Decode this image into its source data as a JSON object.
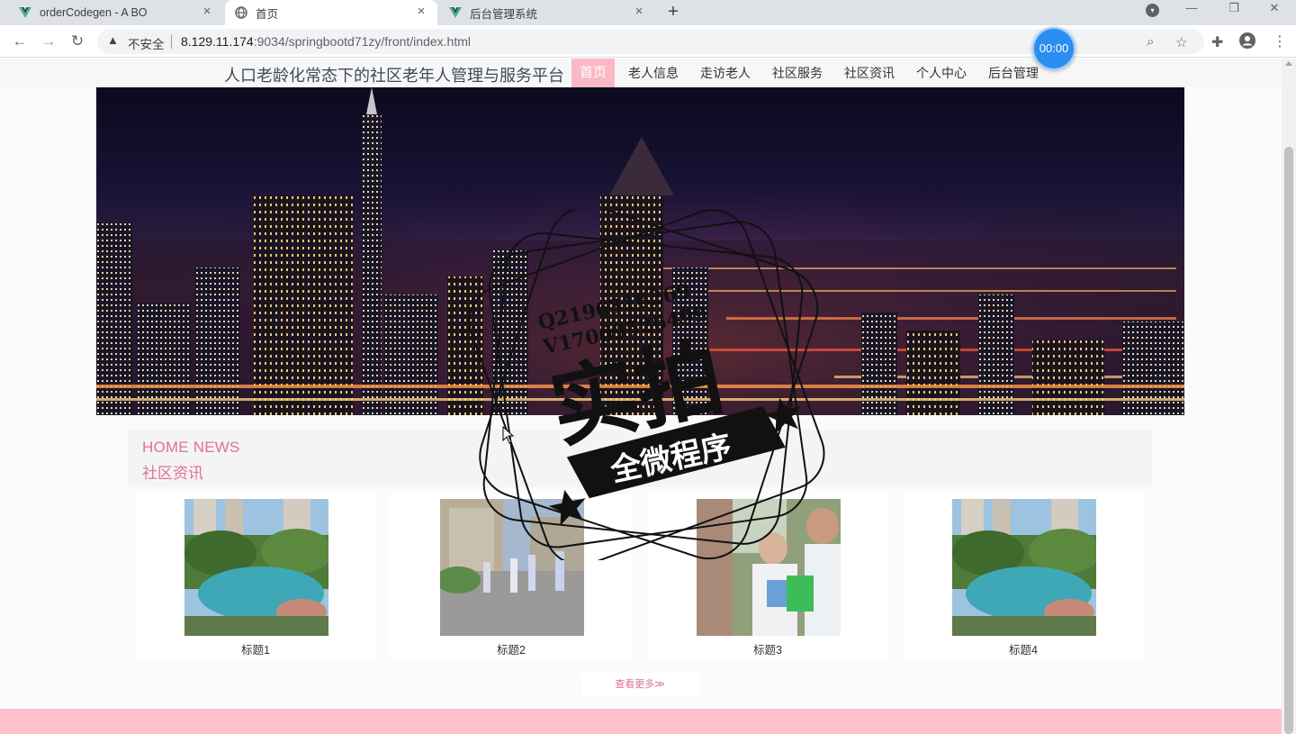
{
  "browser": {
    "tabs": [
      {
        "title": "orderCodegen - A BO",
        "icon": "vue-icon",
        "active": false
      },
      {
        "title": "首页",
        "icon": "globe-icon",
        "active": true
      },
      {
        "title": "后台管理系统",
        "icon": "vue-icon",
        "active": false
      }
    ],
    "security_label": "不安全",
    "url_host": "8.129.11.174",
    "url_rest": ":9034/springbootd71zy/front/index.html",
    "timer": "00:00"
  },
  "site": {
    "title": "人口老龄化常态下的社区老年人管理与服务平台",
    "nav": [
      {
        "label": "首页",
        "active": true
      },
      {
        "label": "老人信息",
        "active": false
      },
      {
        "label": "走访老人",
        "active": false
      },
      {
        "label": "社区服务",
        "active": false
      },
      {
        "label": "社区资讯",
        "active": false
      },
      {
        "label": "个人中心",
        "active": false
      },
      {
        "label": "后台管理",
        "active": false
      }
    ],
    "accent_color": "#e0709a",
    "active_nav_color": "#f9b8c4",
    "footer_color": "#ffc0cb"
  },
  "news": {
    "heading_en": "HOME NEWS",
    "heading_cn": "社区资讯",
    "items": [
      {
        "title": "标题1",
        "image": "garden-pond-photo"
      },
      {
        "title": "标题2",
        "image": "people-walking-photo"
      },
      {
        "title": "标题3",
        "image": "volunteers-photo"
      },
      {
        "title": "标题4",
        "image": "garden-pond-photo"
      }
    ],
    "more_label": "查看更多≫"
  },
  "watermark": {
    "line1": "Q2196316269",
    "line2": "V17069526499",
    "big": "实拍",
    "ribbon": "全微程序"
  }
}
